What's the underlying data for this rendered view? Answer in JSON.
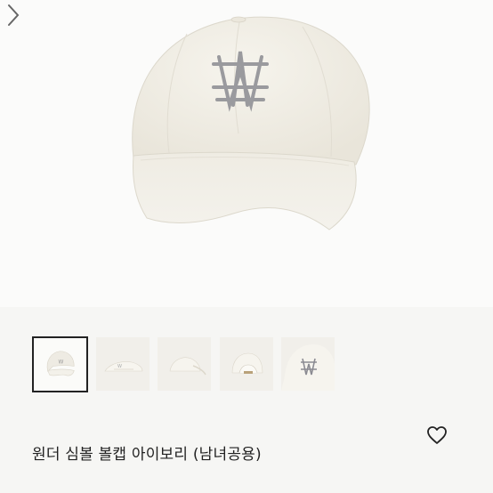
{
  "product": {
    "name": "원더 심볼 볼캡 아이보리 (남녀공용)"
  },
  "gallery": {
    "main_image": "ivory-ball-cap-front",
    "thumbnails": [
      {
        "label": "front-small",
        "selected": true
      },
      {
        "label": "side-flat",
        "selected": false
      },
      {
        "label": "side-angle",
        "selected": false
      },
      {
        "label": "back",
        "selected": false
      },
      {
        "label": "logo-closeup",
        "selected": false
      }
    ]
  },
  "icons": {
    "next": "chevron-right-icon",
    "wishlist": "heart-outline-icon"
  },
  "colors": {
    "cap": "#f2efe6",
    "logo": "#9a9a9e",
    "background": "#fbfbfa",
    "text": "#222222"
  }
}
